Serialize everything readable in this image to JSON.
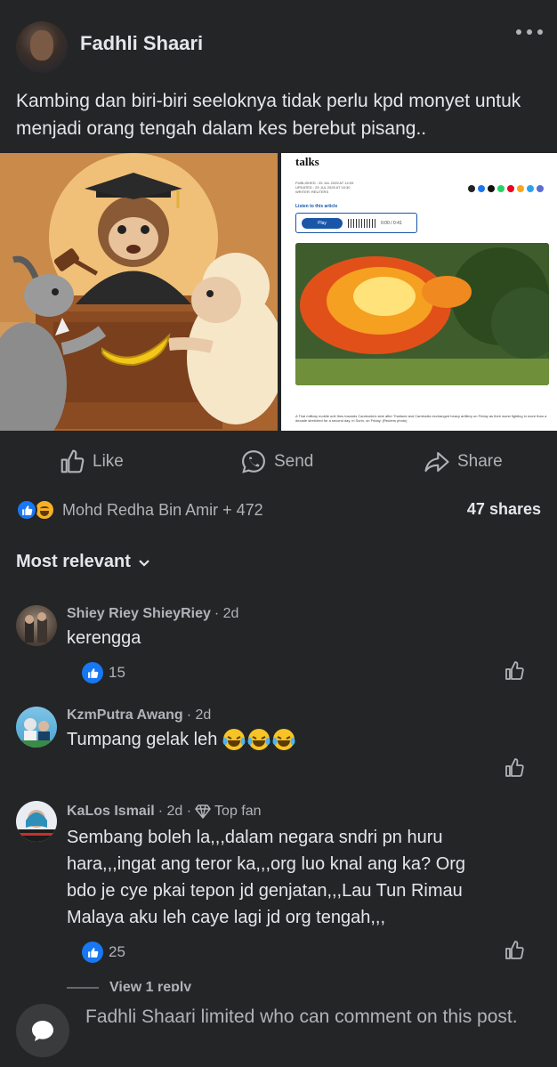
{
  "post": {
    "author": "Fadhli Shaari",
    "text": "Kambing dan biri-biri seeloknya tidak perlu kpd monyet untuk menjadi orang tengah dalam kes berebut pisang..",
    "more_icon": "more-horizontal-icon"
  },
  "article_preview": {
    "title": "talks",
    "meta": [
      "PUBLISHED : 25 JUL 2025 AT 14:09",
      "UPDATED : 25 JUL 2025 AT 15:30",
      "WRITER: REUTERS"
    ],
    "listen_label": "Listen to this article",
    "play_label": "Play",
    "time": "0:00 / 0:41",
    "caption": "A Thai military mobile unit fires towards Cambodia's side after Thailand and Cambodia exchanged heavy artillery on Friday as their worst fighting in more than a decade stretched for a second day, in Surin, on Friday. (Reuters photo)"
  },
  "actions": {
    "like": "Like",
    "send": "Send",
    "share": "Share"
  },
  "stats": {
    "reactions_text": "Mohd Redha Bin Amir + 472",
    "shares": "47 shares"
  },
  "sort_label": "Most relevant",
  "comments": [
    {
      "name": "Shiey Riey ShieyRiey",
      "time": "· 2d",
      "text": "kerengga",
      "likes": "15"
    },
    {
      "name": "KzmPutra Awang",
      "time": "· 2d",
      "text": "Tumpang gelak leh",
      "likes": ""
    },
    {
      "name": "KaLos Ismail",
      "time": "· 2d ·",
      "badge": "Top fan",
      "text": "Sembang boleh la,,,dalam negara sndri pn huru hara,,,ingat ang teror ka,,,org luo knal ang ka? Org bdo je cye pkai tepon jd genjatan,,,Lau Tun Rimau Malaya aku leh caye lagi jd org tengah,,,",
      "likes": "25"
    }
  ],
  "view_reply": "View 1 reply",
  "footer": {
    "name": "Fadhli Shaari",
    "text": " limited who can comment on this post."
  },
  "colors": {
    "background": "#242526",
    "text_primary": "#e4e6eb",
    "text_secondary": "#b0b3b8",
    "like_blue": "#1877f2"
  }
}
